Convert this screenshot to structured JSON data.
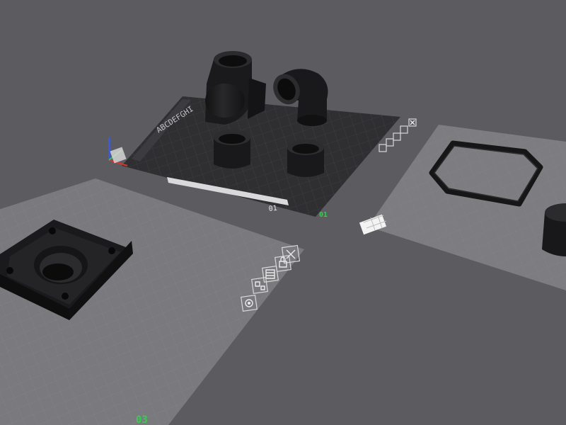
{
  "colors": {
    "background": "#5c5c60",
    "empty_plate": "#7c7c80",
    "active_plate": "#2e2e31",
    "model": "#1b1b1d",
    "plate_label": "#2fd14a",
    "axis_x": "#e0302a",
    "axis_y": "#32c35a",
    "axis_z": "#2f5bff"
  },
  "plates": [
    {
      "id": "plate-1",
      "label": "01",
      "state": "active"
    },
    {
      "id": "plate-2",
      "label": "",
      "state": "empty"
    },
    {
      "id": "plate-3",
      "label": "03",
      "state": "empty"
    }
  ],
  "plate1_bed_text": "ABCDEFGHI",
  "plate1_bed_number": "01",
  "plate_tool_icons": [
    "close-icon",
    "lock-icon",
    "auto-orient-icon",
    "arrange-icon",
    "settings-icon"
  ]
}
